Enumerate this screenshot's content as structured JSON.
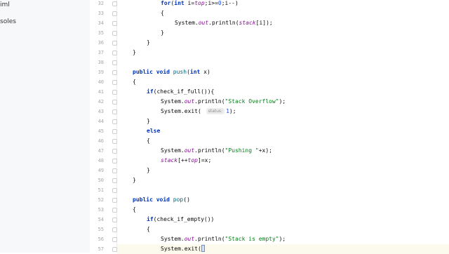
{
  "sidebar": {
    "items": [
      {
        "label": "iml"
      },
      {
        "label": "soles"
      }
    ]
  },
  "editor": {
    "lines": [
      {
        "n": "32",
        "indent": 4,
        "tokens": [
          [
            "kw",
            "for"
          ],
          [
            "p",
            "("
          ],
          [
            "kw",
            "int "
          ],
          [
            "p",
            "i="
          ],
          [
            "fld",
            "top"
          ],
          [
            "p",
            ";i>="
          ],
          [
            "num",
            "0"
          ],
          [
            "p",
            ";i--)"
          ]
        ]
      },
      {
        "n": "33",
        "indent": 4,
        "tokens": [
          [
            "p",
            "{"
          ]
        ]
      },
      {
        "n": "34",
        "indent": 6,
        "tokens": [
          [
            "p",
            "System."
          ],
          [
            "fld",
            "out"
          ],
          [
            "p",
            ".println("
          ],
          [
            "fld",
            "stack"
          ],
          [
            "p",
            "[i]);"
          ]
        ]
      },
      {
        "n": "35",
        "indent": 4,
        "tokens": [
          [
            "p",
            "}"
          ]
        ]
      },
      {
        "n": "36",
        "indent": 2,
        "tokens": [
          [
            "p",
            "}"
          ]
        ]
      },
      {
        "n": "37",
        "indent": 0,
        "tokens": [
          [
            "p",
            "}"
          ]
        ]
      },
      {
        "n": "38",
        "indent": 0,
        "tokens": []
      },
      {
        "n": "39",
        "indent": 0,
        "tokens": [
          [
            "kw",
            "public void "
          ],
          [
            "fn",
            "push"
          ],
          [
            "p",
            "("
          ],
          [
            "kw",
            "int "
          ],
          [
            "p",
            "x)"
          ]
        ]
      },
      {
        "n": "40",
        "indent": 0,
        "tokens": [
          [
            "p",
            "{"
          ]
        ]
      },
      {
        "n": "41",
        "indent": 2,
        "tokens": [
          [
            "kw",
            "if"
          ],
          [
            "p",
            "(check_if_full()){"
          ]
        ]
      },
      {
        "n": "42",
        "indent": 4,
        "tokens": [
          [
            "p",
            "System."
          ],
          [
            "fld",
            "out"
          ],
          [
            "p",
            ".println("
          ],
          [
            "str",
            "\"Stack Overflow\""
          ],
          [
            "p",
            ");"
          ]
        ]
      },
      {
        "n": "43",
        "indent": 4,
        "tokens": [
          [
            "p",
            "System.exit( "
          ],
          [
            "hint",
            "status:"
          ],
          [
            "num",
            "1"
          ],
          [
            "p",
            ");"
          ]
        ]
      },
      {
        "n": "44",
        "indent": 2,
        "tokens": [
          [
            "p",
            "}"
          ]
        ]
      },
      {
        "n": "45",
        "indent": 2,
        "tokens": [
          [
            "kw",
            "else"
          ]
        ]
      },
      {
        "n": "46",
        "indent": 2,
        "tokens": [
          [
            "p",
            "{"
          ]
        ]
      },
      {
        "n": "47",
        "indent": 4,
        "tokens": [
          [
            "p",
            "System."
          ],
          [
            "fld",
            "out"
          ],
          [
            "p",
            ".println("
          ],
          [
            "str",
            "\"Pushing \""
          ],
          [
            "p",
            "+x);"
          ]
        ]
      },
      {
        "n": "48",
        "indent": 4,
        "tokens": [
          [
            "fld",
            "stack"
          ],
          [
            "p",
            "[++"
          ],
          [
            "fld",
            "top"
          ],
          [
            "p",
            "]=x;"
          ]
        ]
      },
      {
        "n": "49",
        "indent": 2,
        "tokens": [
          [
            "p",
            "}"
          ]
        ]
      },
      {
        "n": "50",
        "indent": 0,
        "tokens": [
          [
            "p",
            "}"
          ]
        ]
      },
      {
        "n": "51",
        "indent": 0,
        "tokens": []
      },
      {
        "n": "52",
        "indent": 0,
        "tokens": [
          [
            "kw",
            "public void "
          ],
          [
            "fn",
            "pop"
          ],
          [
            "p",
            "()"
          ]
        ]
      },
      {
        "n": "53",
        "indent": 0,
        "tokens": [
          [
            "p",
            "{"
          ]
        ]
      },
      {
        "n": "54",
        "indent": 2,
        "tokens": [
          [
            "kw",
            "if"
          ],
          [
            "p",
            "(check_if_empty())"
          ]
        ]
      },
      {
        "n": "55",
        "indent": 2,
        "tokens": [
          [
            "p",
            "{"
          ]
        ]
      },
      {
        "n": "56",
        "indent": 4,
        "tokens": [
          [
            "p",
            "System."
          ],
          [
            "fld",
            "out"
          ],
          [
            "p",
            ".println("
          ],
          [
            "str",
            "\"Stack is empty\""
          ],
          [
            "p",
            ");"
          ]
        ]
      },
      {
        "n": "57",
        "indent": 4,
        "tokens": [
          [
            "p",
            "System.exit("
          ],
          [
            "caret",
            ""
          ]
        ],
        "current": true
      }
    ]
  }
}
